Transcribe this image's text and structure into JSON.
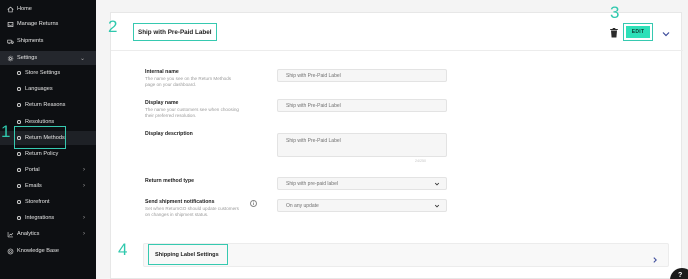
{
  "sidebar": {
    "items": [
      {
        "label": "Home",
        "icon": "home-icon"
      },
      {
        "label": "Manage Returns",
        "icon": "inbox-icon"
      },
      {
        "label": "Shipments",
        "icon": "truck-icon"
      },
      {
        "label": "Settings",
        "icon": "gear-icon"
      },
      {
        "label": "Store Settings"
      },
      {
        "label": "Languages"
      },
      {
        "label": "Return Reasons"
      },
      {
        "label": "Resolutions"
      },
      {
        "label": "Return Methods"
      },
      {
        "label": "Return Policy"
      },
      {
        "label": "Portal"
      },
      {
        "label": "Emails"
      },
      {
        "label": "Storefront"
      },
      {
        "label": "Integrations"
      },
      {
        "label": "Analytics",
        "icon": "chart-icon"
      },
      {
        "label": "Knowledge Base",
        "icon": "book-icon"
      }
    ]
  },
  "panel": {
    "title": "Ship with Pre-Paid Label",
    "edit_label": "EDIT"
  },
  "form": {
    "internal_name": {
      "label": "Internal name",
      "help": "The name you see on the Return Methods page on your dashboard.",
      "value": "Ship with Pre-Paid Label"
    },
    "display_name": {
      "label": "Display name",
      "help": "The name your customers see when choosing their preferred resolution.",
      "value": "Ship with Pre-Paid Label"
    },
    "display_description": {
      "label": "Display description",
      "value": "Ship with Pre-Paid Label",
      "counter": "24/250"
    },
    "return_method_type": {
      "label": "Return method type",
      "value": "Ship with pre-paid label"
    },
    "shipment_notifications": {
      "label": "Send shipment notifications",
      "help": "Set when ReturnGO should update customers on changes in shipment status.",
      "value": "On any update"
    }
  },
  "shipping_label_settings": "Shipping Label Settings",
  "annotations": {
    "n1": "1",
    "n2": "2",
    "n3": "3",
    "n4": "4"
  },
  "colors": {
    "accent": "#2ee0b8",
    "annotation": "#36c9b0",
    "sidebar_bg": "#0d0f12"
  }
}
